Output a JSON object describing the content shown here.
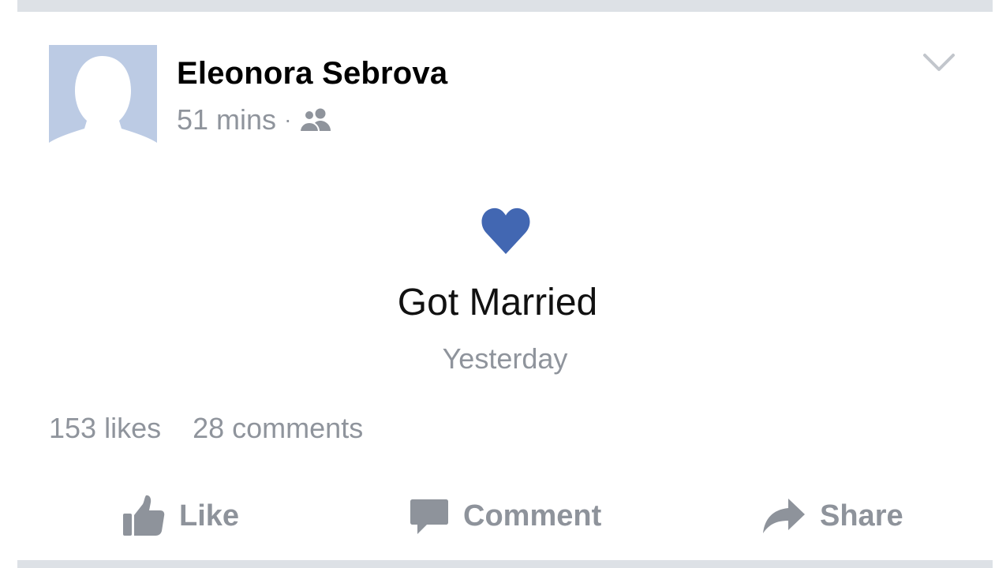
{
  "post": {
    "author_name": "Eleonora Sebrova",
    "timestamp": "51 mins",
    "separator": "·",
    "audience_icon": "friends-icon",
    "menu_icon": "chevron-down-icon"
  },
  "life_event": {
    "icon": "heart-icon",
    "title": "Got Married",
    "date": "Yesterday"
  },
  "stats": {
    "likes": "153 likes",
    "comments": "28 comments"
  },
  "actions": {
    "like_label": "Like",
    "comment_label": "Comment",
    "share_label": "Share"
  },
  "colors": {
    "accent_heart": "#4267b2",
    "avatar_background": "#bccbe4",
    "secondary_text": "#8f949c",
    "divider": "#dde1e6"
  }
}
